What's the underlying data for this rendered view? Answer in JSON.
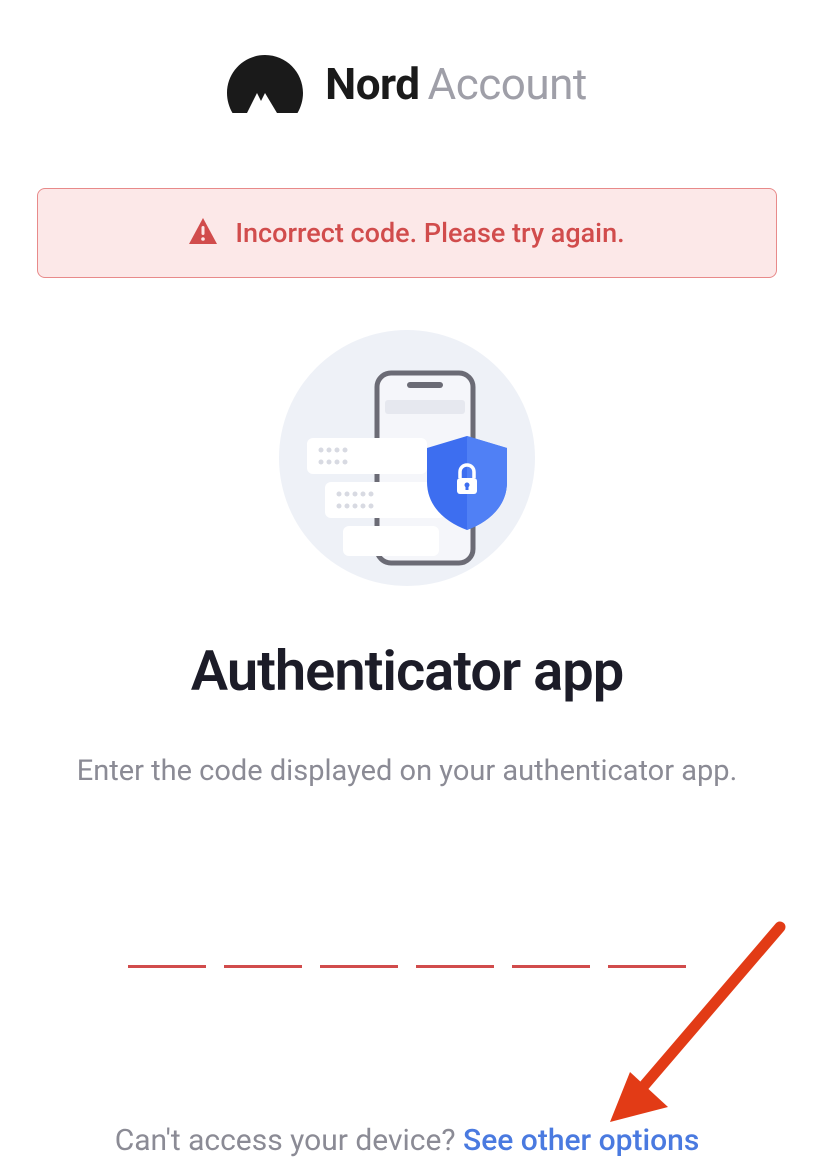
{
  "header": {
    "brand_bold": "Nord",
    "brand_light": "Account"
  },
  "alert": {
    "message": "Incorrect code. Please try again."
  },
  "main": {
    "title": "Authenticator app",
    "subtitle": "Enter the code displayed on your authenticator app."
  },
  "code_input": {
    "digits": [
      "",
      "",
      "",
      "",
      "",
      ""
    ]
  },
  "footer": {
    "prompt": "Can't access your device? ",
    "link_text": "See other options"
  },
  "colors": {
    "error": "#d14c4c",
    "error_bg": "#fce8e8",
    "error_border": "#e88a8a",
    "link": "#4a7ae0",
    "text_muted": "#8b8b95",
    "text_dark": "#1c1c28"
  }
}
